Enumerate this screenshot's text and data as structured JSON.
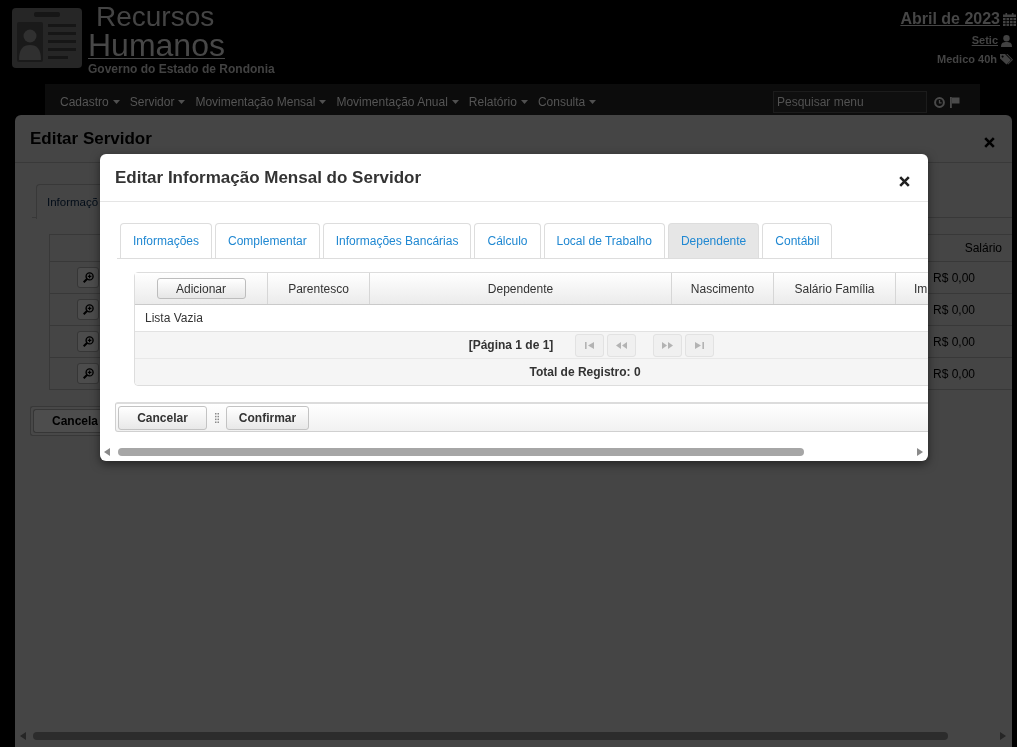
{
  "header": {
    "brand": {
      "title": "Recursos",
      "subtitle": "Humanos",
      "organization": "Governo do Estado de Rondonia"
    },
    "period": "Abril de 2023",
    "user": "Setic",
    "role": "Medico 40h"
  },
  "menu": {
    "items": [
      {
        "label": "Cadastro"
      },
      {
        "label": "Servidor"
      },
      {
        "label": "Movimentação Mensal"
      },
      {
        "label": "Movimentação Anual"
      },
      {
        "label": "Relatório"
      },
      {
        "label": "Consulta"
      }
    ],
    "search": {
      "placeholder": "Pesquisar menu"
    }
  },
  "page_dialog": {
    "title": "Editar Servidor",
    "tabs": [
      {
        "label": "Informaçõ",
        "selected": true
      }
    ],
    "table": {
      "columns": [
        "Salário"
      ],
      "rows": [
        {
          "salary": "R$ 0,00"
        },
        {
          "salary": "R$ 0,00"
        },
        {
          "salary": "R$ 0,00"
        },
        {
          "salary": "R$ 0,00"
        }
      ]
    },
    "buttons": [
      {
        "label": "Cancela"
      }
    ]
  },
  "modal": {
    "title": "Editar Informação Mensal do Servidor",
    "tabs": [
      {
        "label": "Informações",
        "selected": false
      },
      {
        "label": "Complementar",
        "selected": false
      },
      {
        "label": "Informações Bancárias",
        "selected": false
      },
      {
        "label": "Cálculo",
        "selected": false
      },
      {
        "label": "Local de Trabalho",
        "selected": false
      },
      {
        "label": "Dependente",
        "selected": true
      },
      {
        "label": "Contábil",
        "selected": false
      }
    ],
    "table": {
      "add_button": "Adicionar",
      "columns": [
        "Parentesco",
        "Dependente",
        "Nascimento",
        "Salário Família",
        "Im"
      ],
      "empty_message": "Lista Vazia",
      "paginator": {
        "page_report": "[Página 1 de 1]",
        "buttons": [
          {
            "kind": "first",
            "disabled": true
          },
          {
            "kind": "previous",
            "disabled": true
          },
          {
            "kind": "next",
            "disabled": true
          },
          {
            "kind": "last",
            "disabled": true
          }
        ]
      },
      "total": "Total de Registro: 0"
    },
    "buttons": [
      {
        "label": "Cancelar"
      },
      {
        "label": "Confirmar"
      }
    ]
  }
}
